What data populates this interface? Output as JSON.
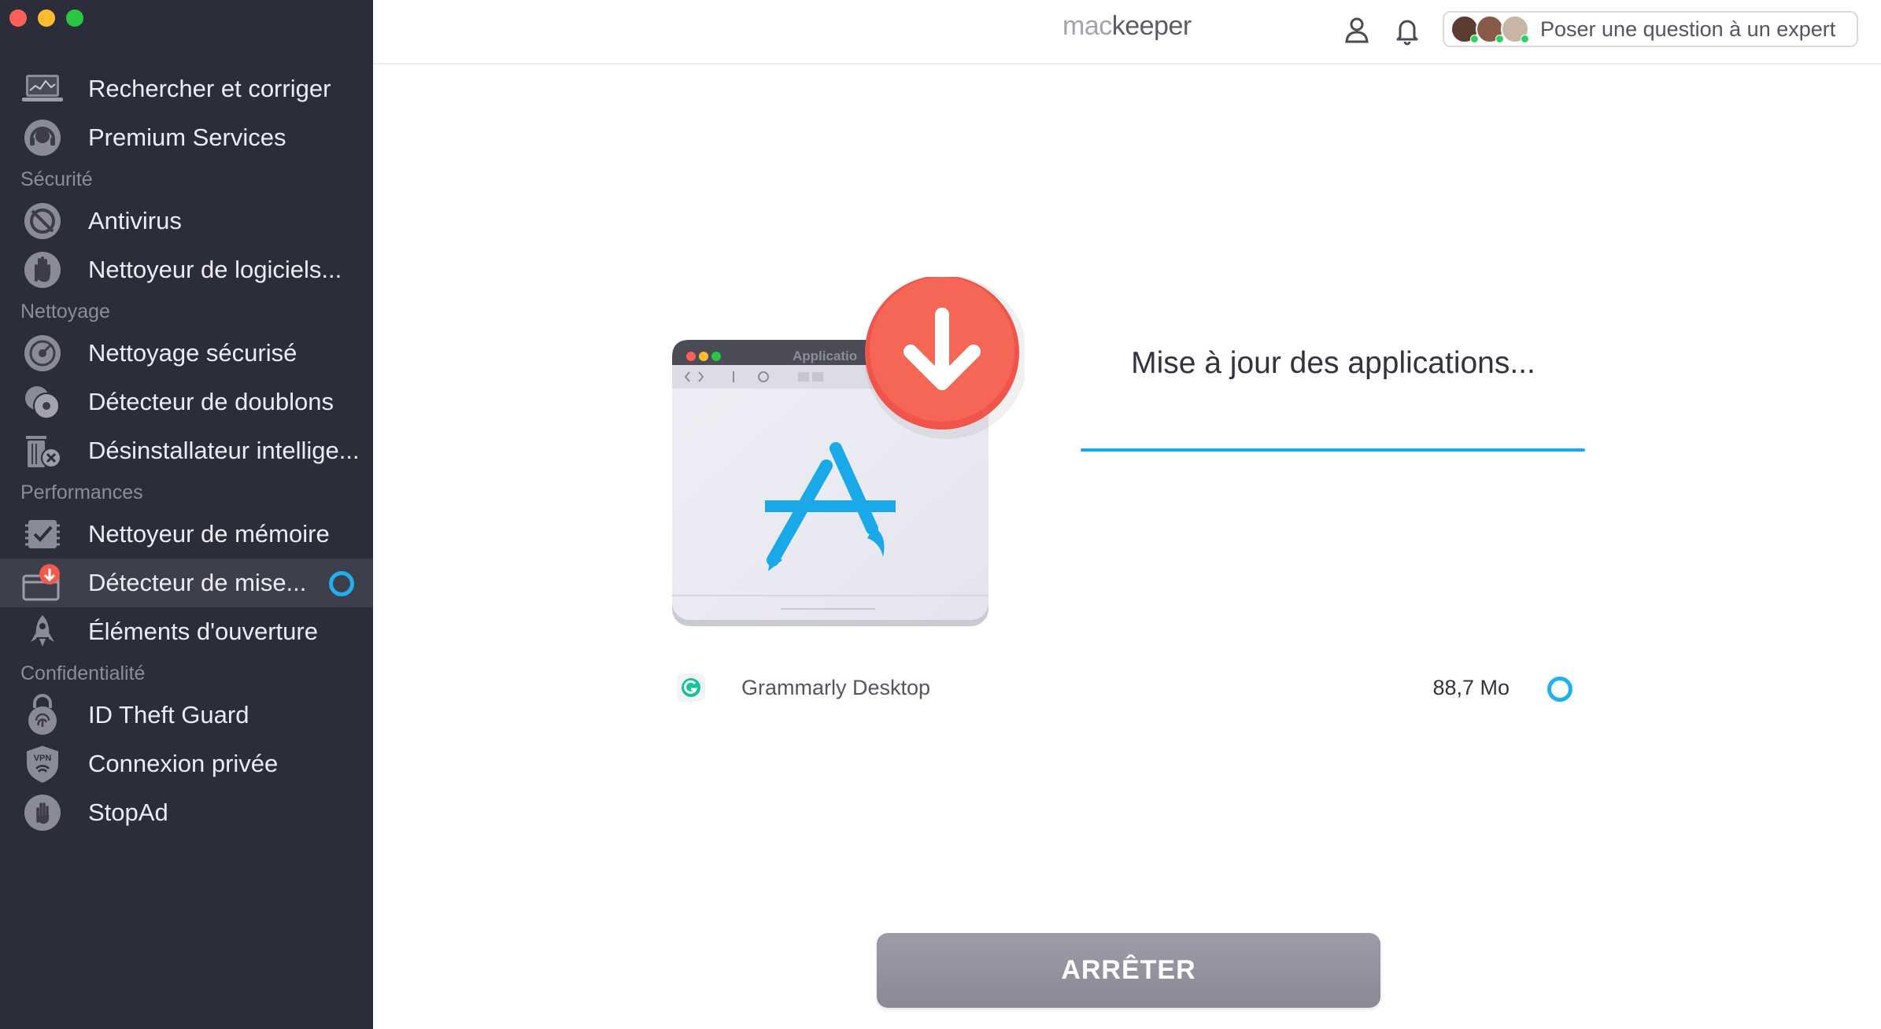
{
  "sidebar": {
    "top_items": [
      {
        "label": "Rechercher et corriger",
        "icon": "laptop-scan-icon"
      },
      {
        "label": "Premium Services",
        "icon": "headset-icon"
      }
    ],
    "sections": [
      {
        "label": "Sécurité",
        "items": [
          {
            "label": "Antivirus",
            "icon": "antivirus-icon"
          },
          {
            "label": "Nettoyeur de logiciels...",
            "icon": "hand-stop-icon"
          }
        ]
      },
      {
        "label": "Nettoyage",
        "items": [
          {
            "label": "Nettoyage sécurisé",
            "icon": "disk-clean-icon"
          },
          {
            "label": "Détecteur de doublons",
            "icon": "duplicates-icon"
          },
          {
            "label": "Désinstallateur intellige...",
            "icon": "uninstaller-icon"
          }
        ]
      },
      {
        "label": "Performances",
        "items": [
          {
            "label": "Nettoyeur de mémoire",
            "icon": "memory-check-icon"
          },
          {
            "label": "Détecteur de mise...",
            "icon": "update-tracker-icon",
            "active": true
          },
          {
            "label": "Éléments d'ouverture",
            "icon": "rocket-icon"
          }
        ]
      },
      {
        "label": "Confidentialité",
        "items": [
          {
            "label": "ID Theft Guard",
            "icon": "fingerprint-lock-icon"
          },
          {
            "label": "Connexion privée",
            "icon": "vpn-shield-icon"
          },
          {
            "label": "StopAd",
            "icon": "stopad-hand-icon"
          }
        ]
      }
    ]
  },
  "header": {
    "brand_mac": "mac",
    "brand_keeper": "keeper",
    "expert_label": "Poser une question à un expert"
  },
  "hero": {
    "window_title": "Applicatio"
  },
  "main": {
    "status_title": "Mise à jour des applications...",
    "progress": 1.0,
    "app": {
      "name": "Grammarly Desktop",
      "size": "88,7 Mo"
    },
    "stop_label": "ARRÊTER"
  },
  "colors": {
    "sidebar_bg": "#2c2d3a",
    "accent_blue": "#1aa9e8",
    "download_red": "#f25a4e",
    "button_gray": "#9c9ca8"
  }
}
